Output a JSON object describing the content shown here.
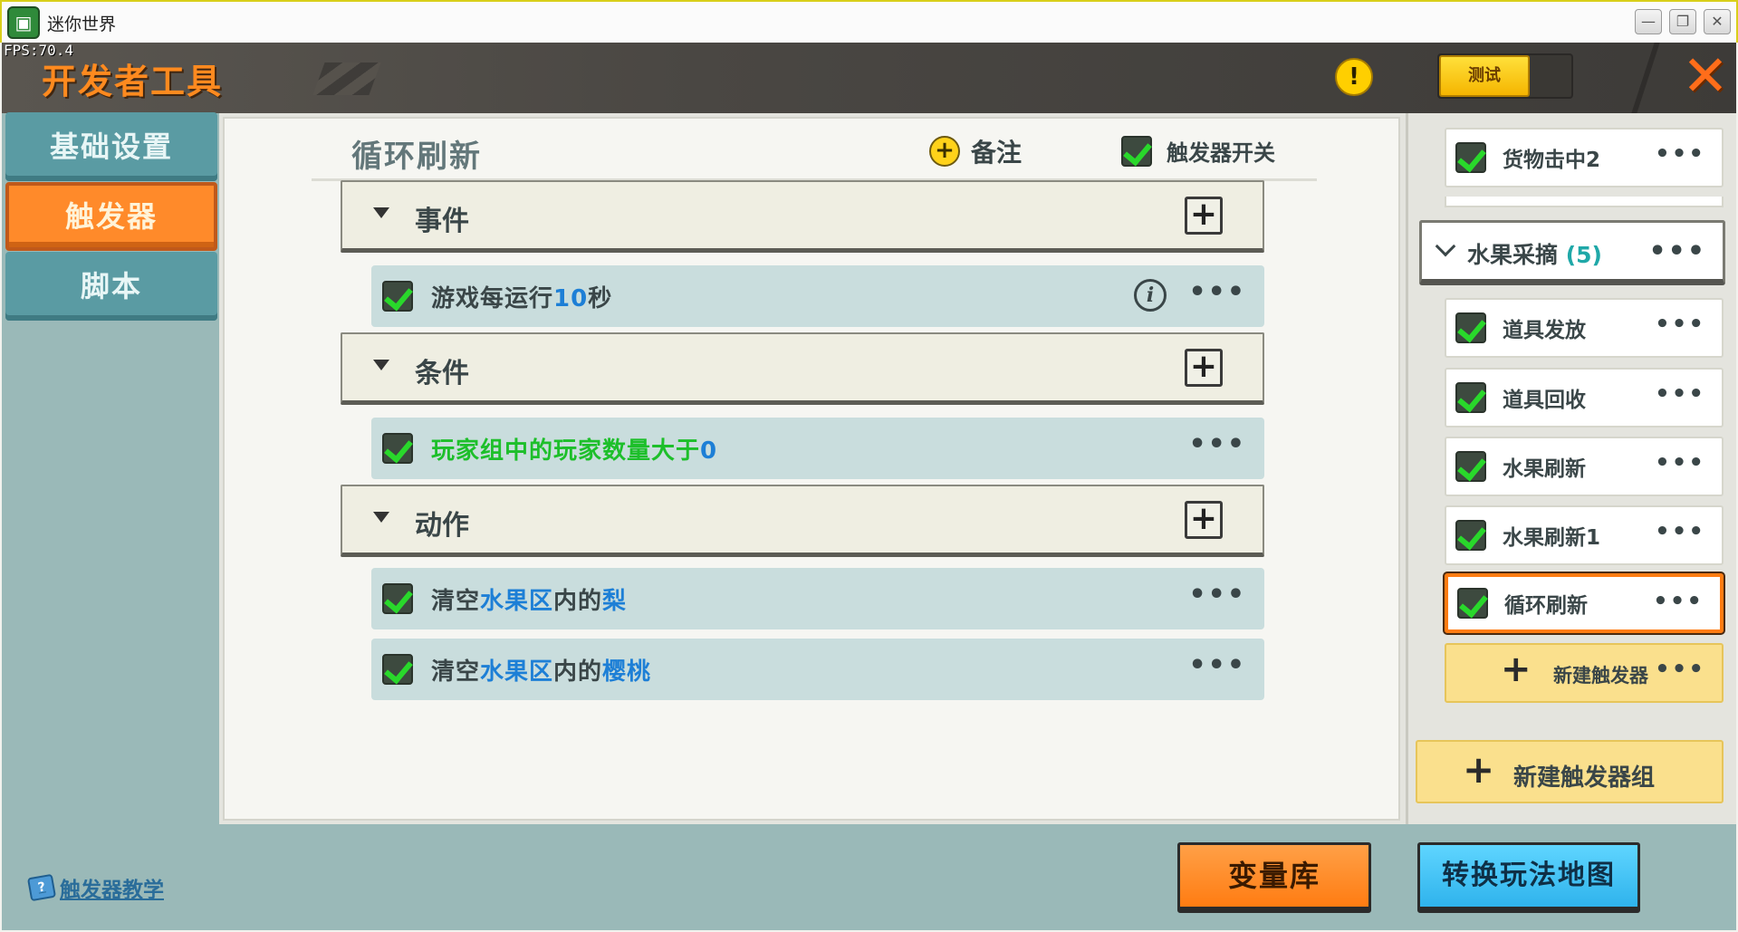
{
  "window": {
    "title": "迷你世界",
    "fps": "FPS:70.4",
    "minimize_glyph": "—",
    "restore_glyph": "❐",
    "close_glyph": "✕"
  },
  "header": {
    "title": "开发者工具",
    "warning_glyph": "!",
    "test_label": "测试",
    "close_glyph": "✕"
  },
  "leftnav": {
    "items": [
      {
        "label": "基础设置",
        "active": false
      },
      {
        "label": "触发器",
        "active": true
      },
      {
        "label": "脚本",
        "active": false
      }
    ],
    "tutorial_label": "触发器教学"
  },
  "editor": {
    "title": "循环刷新",
    "note_label": "备注",
    "plus_glyph": "+",
    "switch_label": "触发器开关",
    "sections": [
      {
        "label": "事件",
        "add_glyph": "+"
      },
      {
        "label": "条件",
        "add_glyph": "+"
      },
      {
        "label": "动作",
        "add_glyph": "+"
      }
    ],
    "event_row": {
      "prefix": "游戏每运行",
      "number": "10",
      "suffix": "秒",
      "info_glyph": "i"
    },
    "condition_row": {
      "prefix": "玩家组中的玩家数量大于",
      "number": "0"
    },
    "action_rows": [
      {
        "p1": "清空",
        "area": "水果区",
        "p2": "内的",
        "item": "梨"
      },
      {
        "p1": "清空",
        "area": "水果区",
        "p2": "内的",
        "item": "樱桃"
      }
    ],
    "more_glyph": "•••"
  },
  "triggers": {
    "top_item": "货物击中2",
    "group": {
      "name": "水果采摘",
      "count": "(5)"
    },
    "items": [
      "道具发放",
      "道具回收",
      "水果刷新",
      "水果刷新1",
      "循环刷新"
    ],
    "active_item": "循环刷新",
    "new_trigger_label": "新建触发器",
    "new_group_label": "新建触发器组",
    "plus_glyph": "+",
    "more_glyph": "•••"
  },
  "bottom": {
    "variable_library_label": "变量库",
    "convert_map_label": "转换玩法地图"
  },
  "colors": {
    "accent_orange": "#ff8a1f",
    "panel_teal": "#9ab9b8",
    "highlight_blue": "#1d7fd6",
    "highlight_green": "#1dbf2a"
  }
}
